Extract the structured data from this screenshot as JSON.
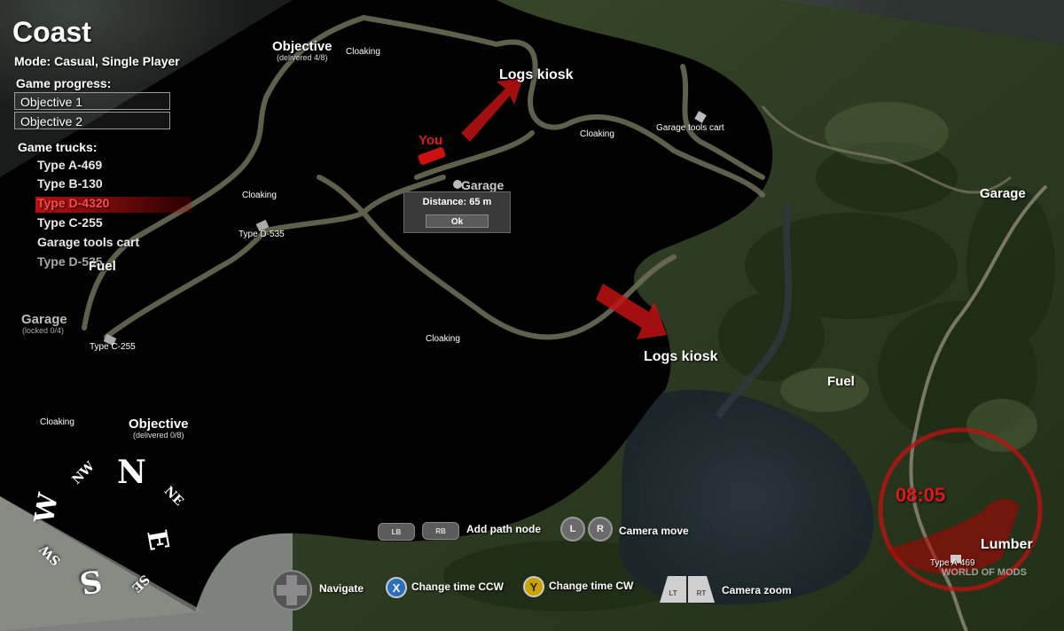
{
  "map": {
    "title": "Coast",
    "mode": "Mode: Casual, Single Player"
  },
  "progress": {
    "heading": "Game progress:",
    "objectives": [
      "Objective 1",
      "Objective 2"
    ]
  },
  "trucks": {
    "heading": "Game trucks:",
    "items": [
      "Type A-469",
      "Type B-130",
      "Type D-4320",
      "Type C-255",
      "Garage tools cart",
      "Type D-535"
    ],
    "selected_index": 2
  },
  "labels": {
    "objective_top": "Objective",
    "objective_top_sub": "(delivered 4/8)",
    "objective_bottom": "Objective",
    "objective_bottom_sub": "(delivered 0/8)",
    "cloaking": "Cloaking",
    "logs_kiosk": "Logs kiosk",
    "garage": "Garage",
    "garage_locked_sub": "(locked 0/4)",
    "fuel": "Fuel",
    "lumber": "Lumber",
    "you": "You",
    "garage_tools_cart": "Garage tools cart",
    "type_d535": "Type D-535",
    "type_c255": "Type C-255",
    "type_a469": "Type A-469"
  },
  "popup": {
    "distance": "Distance: 65 m",
    "ok": "Ok"
  },
  "controls": {
    "lb": "LB",
    "rb": "RB",
    "add_path_node": "Add path node",
    "l": "L",
    "r": "R",
    "camera_move": "Camera move",
    "navigate": "Navigate",
    "x": "X",
    "change_time_ccw": "Change time CCW",
    "y": "Y",
    "change_time_cw": "Change time CW",
    "lt": "LT",
    "rt": "RT",
    "camera_zoom": "Camera zoom"
  },
  "clock": {
    "time": "08:05"
  },
  "compass": {
    "n": "N",
    "ne": "NE",
    "e": "E",
    "se": "SE",
    "s": "S",
    "sw": "SW",
    "w": "W",
    "nw": "NW"
  },
  "watermark": "WORLD OF MODS",
  "colors": {
    "accent_red": "#d01010",
    "fog": "#000000",
    "terrain": "#2f3a28"
  }
}
